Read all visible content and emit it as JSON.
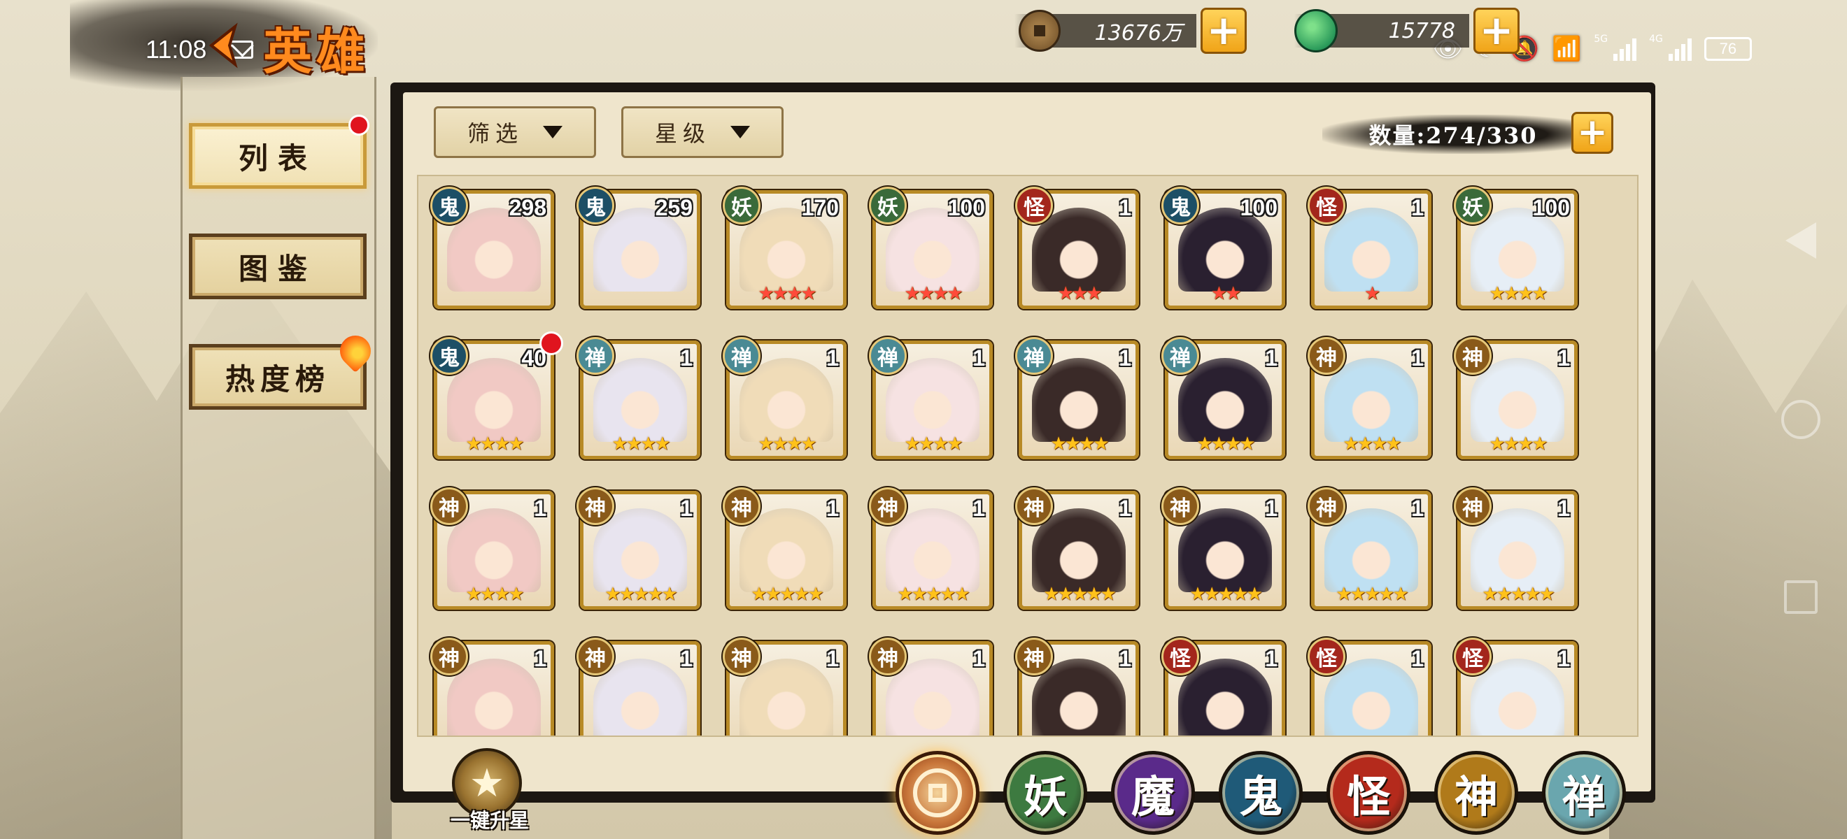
{
  "status_bar": {
    "time": "11:08",
    "battery": "76",
    "net_label": "5G",
    "net_label2": "4G"
  },
  "header": {
    "title": "英雄"
  },
  "currency": [
    {
      "name": "copper-coins",
      "value": "13676万"
    },
    {
      "name": "jade",
      "value": "15778"
    }
  ],
  "side_menu": [
    {
      "label": "列表",
      "active": true
    },
    {
      "label": "图鉴",
      "active": false
    },
    {
      "label": "热度榜",
      "active": false
    }
  ],
  "filters": {
    "filter_label": "筛选",
    "star_label": "星级"
  },
  "count": {
    "label": "数量:274/330"
  },
  "heroes": [
    {
      "type": "鬼",
      "level": "298",
      "stars": "",
      "star_color": "none"
    },
    {
      "type": "鬼",
      "level": "259",
      "stars": "",
      "star_color": "none"
    },
    {
      "type": "妖",
      "level": "170",
      "stars": "★★★★",
      "star_color": "red"
    },
    {
      "type": "妖",
      "level": "100",
      "stars": "★★★★",
      "star_color": "red"
    },
    {
      "type": "怪",
      "level": "1",
      "stars": "★★★",
      "star_color": "red"
    },
    {
      "type": "鬼",
      "level": "100",
      "stars": "★★",
      "star_color": "red"
    },
    {
      "type": "怪",
      "level": "1",
      "stars": "★",
      "star_color": "red"
    },
    {
      "type": "妖",
      "level": "100",
      "stars": "★★★★",
      "star_color": "gold"
    },
    {
      "type": "鬼",
      "level": "40",
      "stars": "★★★★",
      "star_color": "gold"
    },
    {
      "type": "禅",
      "level": "1",
      "stars": "★★★★",
      "star_color": "gold"
    },
    {
      "type": "禅",
      "level": "1",
      "stars": "★★★★",
      "star_color": "gold"
    },
    {
      "type": "禅",
      "level": "1",
      "stars": "★★★★",
      "star_color": "gold"
    },
    {
      "type": "禅",
      "level": "1",
      "stars": "★★★★",
      "star_color": "gold"
    },
    {
      "type": "禅",
      "level": "1",
      "stars": "★★★★",
      "star_color": "gold"
    },
    {
      "type": "神",
      "level": "1",
      "stars": "★★★★",
      "star_color": "gold"
    },
    {
      "type": "神",
      "level": "1",
      "stars": "★★★★",
      "star_color": "gold"
    },
    {
      "type": "神",
      "level": "1",
      "stars": "★★★★",
      "star_color": "gold"
    },
    {
      "type": "神",
      "level": "1",
      "stars": "★★★★★",
      "star_color": "gold"
    },
    {
      "type": "神",
      "level": "1",
      "stars": "★★★★★",
      "star_color": "gold"
    },
    {
      "type": "神",
      "level": "1",
      "stars": "★★★★★",
      "star_color": "gold"
    },
    {
      "type": "神",
      "level": "1",
      "stars": "★★★★★",
      "star_color": "gold"
    },
    {
      "type": "神",
      "level": "1",
      "stars": "★★★★★",
      "star_color": "gold"
    },
    {
      "type": "神",
      "level": "1",
      "stars": "★★★★★",
      "star_color": "gold"
    },
    {
      "type": "神",
      "level": "1",
      "stars": "★★★★★",
      "star_color": "gold"
    },
    {
      "type": "神",
      "level": "1",
      "stars": "",
      "star_color": "none"
    },
    {
      "type": "神",
      "level": "1",
      "stars": "",
      "star_color": "none"
    },
    {
      "type": "神",
      "level": "1",
      "stars": "",
      "star_color": "none"
    },
    {
      "type": "神",
      "level": "1",
      "stars": "",
      "star_color": "none"
    },
    {
      "type": "神",
      "level": "1",
      "stars": "",
      "star_color": "none"
    },
    {
      "type": "怪",
      "level": "1",
      "stars": "",
      "star_color": "none"
    },
    {
      "type": "怪",
      "level": "1",
      "stars": "",
      "star_color": "none"
    },
    {
      "type": "怪",
      "level": "1",
      "stars": "",
      "star_color": "none"
    }
  ],
  "type_colors": {
    "鬼": "#1d4f66",
    "妖": "#3a6a3a",
    "怪": "#a3261c",
    "禅": "#4a8a94",
    "神": "#8a5a1a"
  },
  "bottom": {
    "upstar_label": "一键升星",
    "type_tabs": [
      {
        "label": "",
        "id": "all",
        "color": "#c8763a"
      },
      {
        "label": "妖",
        "id": "yao",
        "color": "#3d7a40"
      },
      {
        "label": "魔",
        "id": "mo",
        "color": "#5a2a8a"
      },
      {
        "label": "鬼",
        "id": "gui",
        "color": "#1f5a78"
      },
      {
        "label": "怪",
        "id": "guai",
        "color": "#b42a1c"
      },
      {
        "label": "神",
        "id": "shen",
        "color": "#b07a1a"
      },
      {
        "label": "禅",
        "id": "chan",
        "color": "#6aa6ae"
      }
    ]
  }
}
